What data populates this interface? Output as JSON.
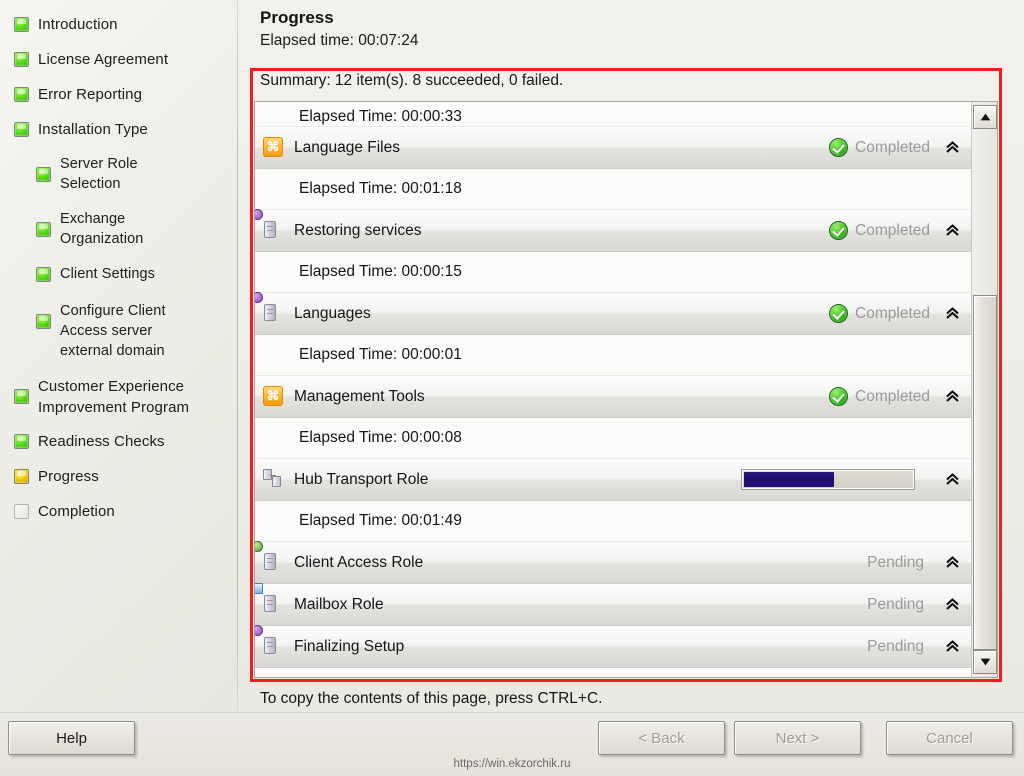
{
  "sidebar": {
    "items": [
      {
        "label": "Introduction",
        "state": "green",
        "level": 0,
        "lines": 1
      },
      {
        "label": "License Agreement",
        "state": "green",
        "level": 0,
        "lines": 1
      },
      {
        "label": "Error Reporting",
        "state": "green",
        "level": 0,
        "lines": 1
      },
      {
        "label": "Installation Type",
        "state": "green",
        "level": 0,
        "lines": 1
      },
      {
        "label": "Server Role Selection",
        "state": "green",
        "level": 1,
        "lines": 2
      },
      {
        "label": "Exchange Organization",
        "state": "green",
        "level": 1,
        "lines": 2
      },
      {
        "label": "Client Settings",
        "state": "green",
        "level": 1,
        "lines": 1
      },
      {
        "label": "Configure Client Access server external domain",
        "state": "green",
        "level": 1,
        "lines": 3
      },
      {
        "label": "Customer Experience Improvement Program",
        "state": "green",
        "level": 0,
        "lines": 2
      },
      {
        "label": "Readiness Checks",
        "state": "green",
        "level": 0,
        "lines": 1
      },
      {
        "label": "Progress",
        "state": "yellow",
        "level": 0,
        "lines": 1
      },
      {
        "label": "Completion",
        "state": "empty",
        "level": 0,
        "lines": 1
      }
    ],
    "help_label": "Help"
  },
  "header": {
    "title": "Progress",
    "elapsed": "Elapsed time: 00:07:24",
    "summary": "Summary: 12 item(s). 8 succeeded, 0 failed."
  },
  "progress_list": [
    {
      "kind": "detail",
      "clipped": true,
      "label": "Elapsed Time: 00:00:33"
    },
    {
      "kind": "task",
      "icon": "exchange-icon",
      "label": "Language Files",
      "status": "Completed",
      "state": "completed"
    },
    {
      "kind": "detail",
      "clipped": false,
      "label": "Elapsed Time: 00:01:18"
    },
    {
      "kind": "task",
      "icon": "server-services-icon",
      "label": "Restoring services",
      "status": "Completed",
      "state": "completed"
    },
    {
      "kind": "detail",
      "clipped": false,
      "label": "Elapsed Time: 00:00:15"
    },
    {
      "kind": "task",
      "icon": "server-services-icon",
      "label": "Languages",
      "status": "Completed",
      "state": "completed"
    },
    {
      "kind": "detail",
      "clipped": false,
      "label": "Elapsed Time: 00:00:01"
    },
    {
      "kind": "task",
      "icon": "exchange-icon",
      "label": "Management Tools",
      "status": "Completed",
      "state": "completed"
    },
    {
      "kind": "detail",
      "clipped": false,
      "label": "Elapsed Time: 00:00:08"
    },
    {
      "kind": "task",
      "icon": "hub-transport-icon",
      "label": "Hub Transport Role",
      "status": "",
      "state": "running",
      "progress_percent": 53
    },
    {
      "kind": "detail",
      "clipped": false,
      "label": "Elapsed Time: 00:01:49"
    },
    {
      "kind": "task",
      "icon": "client-access-icon",
      "label": "Client Access Role",
      "status": "Pending",
      "state": "pending"
    },
    {
      "kind": "task",
      "icon": "mailbox-icon",
      "label": "Mailbox Role",
      "status": "Pending",
      "state": "pending"
    },
    {
      "kind": "task",
      "icon": "finalizing-icon",
      "label": "Finalizing Setup",
      "status": "Pending",
      "state": "pending"
    }
  ],
  "footer": {
    "copy_hint": "To copy the contents of this page, press CTRL+C.",
    "back_label": "< Back",
    "next_label": "Next >",
    "cancel_label": "Cancel"
  },
  "watermark": "https://win.ekzorchik.ru",
  "colors": {
    "highlight_border": "#f21d1d",
    "progress_fill": "#1d0c6e",
    "status_completed": "#9a9a9a",
    "step_done": "#59e016",
    "step_current": "#f0c800"
  }
}
